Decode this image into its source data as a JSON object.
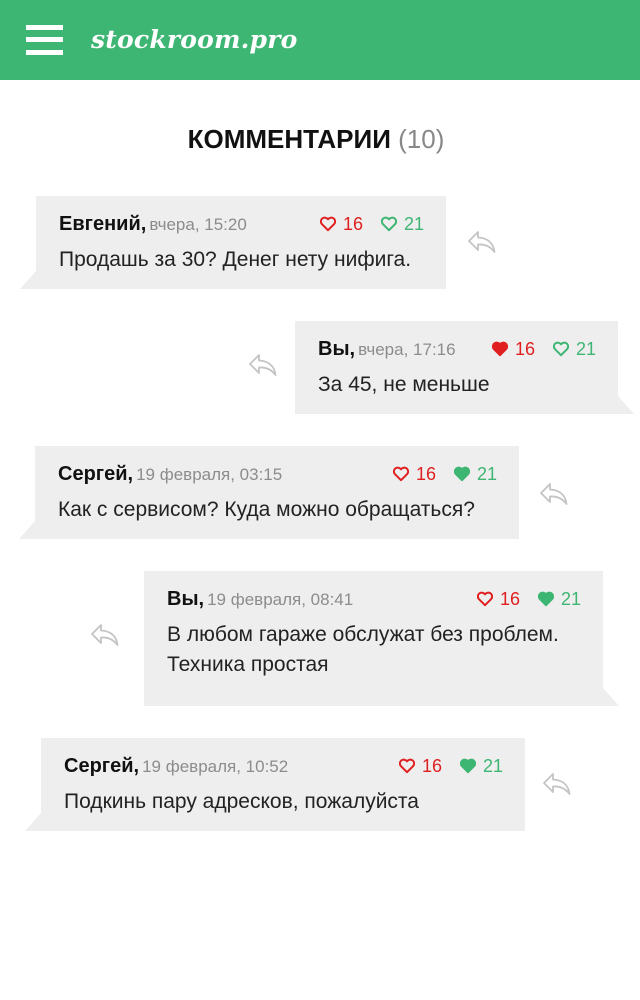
{
  "header": {
    "logo_text": "stockroom.pro",
    "menu_icon": "hamburger-menu-icon",
    "bar_color": "#3eb673"
  },
  "comments_section": {
    "title": "КОММЕНТАРИИ",
    "count": "(10)"
  },
  "icons": {
    "dislike": "heart-red-icon",
    "like": "heart-green-icon",
    "reply": "reply-arrow-icon"
  },
  "colors": {
    "dislike": "#e02020",
    "like": "#3eb673",
    "bubble": "#eeeeee",
    "meta_text": "#8c8c8c"
  },
  "comments": [
    {
      "author": "Евгений,",
      "date": "вчера, 15:20",
      "dislikes": "16",
      "likes": "21",
      "dislike_filled": false,
      "like_filled": false,
      "text": "Продашь за 30? Денег нету нифига.",
      "side": "left"
    },
    {
      "author": "Вы,",
      "date": "вчера, 17:16",
      "dislikes": "16",
      "likes": "21",
      "dislike_filled": true,
      "like_filled": false,
      "text": "За 45, не меньше",
      "side": "right"
    },
    {
      "author": "Сергей,",
      "date": "19 февраля, 03:15",
      "dislikes": "16",
      "likes": "21",
      "dislike_filled": false,
      "like_filled": true,
      "text": "Как с сервисом? Куда можно обращаться?",
      "side": "left"
    },
    {
      "author": "Вы,",
      "date": "19 февраля, 08:41",
      "dislikes": "16",
      "likes": "21",
      "dislike_filled": false,
      "like_filled": true,
      "text": "В любом гараже обслужат без проблем. Техника простая",
      "side": "right"
    },
    {
      "author": "Сергей,",
      "date": "19 февраля, 10:52",
      "dislikes": "16",
      "likes": "21",
      "dislike_filled": false,
      "like_filled": true,
      "text": "Подкинь пару адресков, пожалуйста",
      "side": "left"
    }
  ]
}
